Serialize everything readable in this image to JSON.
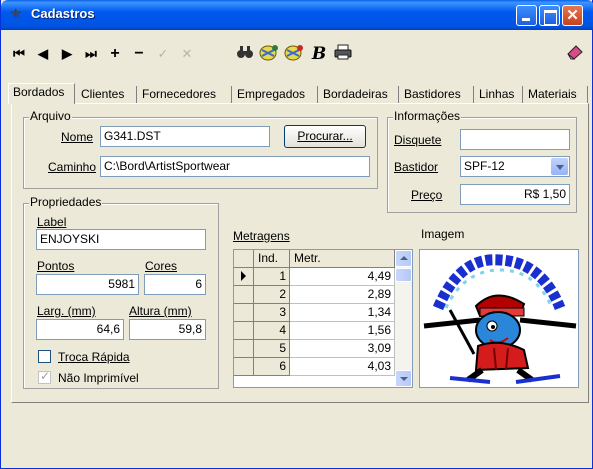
{
  "window": {
    "title": "Cadastros"
  },
  "toolbar": {
    "icons": [
      "first-record-icon",
      "prev-record-icon",
      "next-record-icon",
      "last-record-icon",
      "add-icon",
      "delete-icon",
      "confirm-icon",
      "cancel-icon",
      "search-icon",
      "import-icon",
      "export-icon",
      "bold-icon",
      "print-icon",
      "eraser-icon"
    ]
  },
  "tabs": [
    "Bordados",
    "Clientes",
    "Fornecedores",
    "Empregados",
    "Bordadeiras",
    "Bastidores",
    "Linhas",
    "Materiais"
  ],
  "arquivo": {
    "legend": "Arquivo",
    "nome_label": "Nome",
    "nome_value": "G341.DST",
    "procurar_label": "Procurar...",
    "caminho_label": "Caminho",
    "caminho_value": "C:\\Bord\\ArtistSportwear"
  },
  "informacoes": {
    "legend": "Informações",
    "disquete_label": "Disquete",
    "disquete_value": "",
    "bastidor_label": "Bastidor",
    "bastidor_value": "SPF-12",
    "preco_label": "Preço",
    "preco_value": "R$ 1,50"
  },
  "propriedades": {
    "legend": "Propriedades",
    "label_label": "Label",
    "label_value": "ENJOYSKI",
    "pontos_label": "Pontos",
    "pontos_value": "5981",
    "cores_label": "Cores",
    "cores_value": "6",
    "larg_label": "Larg. (mm)",
    "larg_value": "64,6",
    "altura_label": "Altura (mm)",
    "altura_value": "59,8",
    "troca_label": "Troca Rápida",
    "troca_checked": false,
    "naoimp_label": "Não Imprimível",
    "naoimp_checked": true
  },
  "metragens": {
    "title": "Metragens",
    "headers": [
      "Ind.",
      "Metr."
    ],
    "rows": [
      {
        "ind": "1",
        "metr": "4,49"
      },
      {
        "ind": "2",
        "metr": "2,89"
      },
      {
        "ind": "3",
        "metr": "1,34"
      },
      {
        "ind": "4",
        "metr": "1,56"
      },
      {
        "ind": "5",
        "metr": "3,09"
      },
      {
        "ind": "6",
        "metr": "4,03"
      }
    ]
  },
  "imagem": {
    "title": "Imagem"
  }
}
